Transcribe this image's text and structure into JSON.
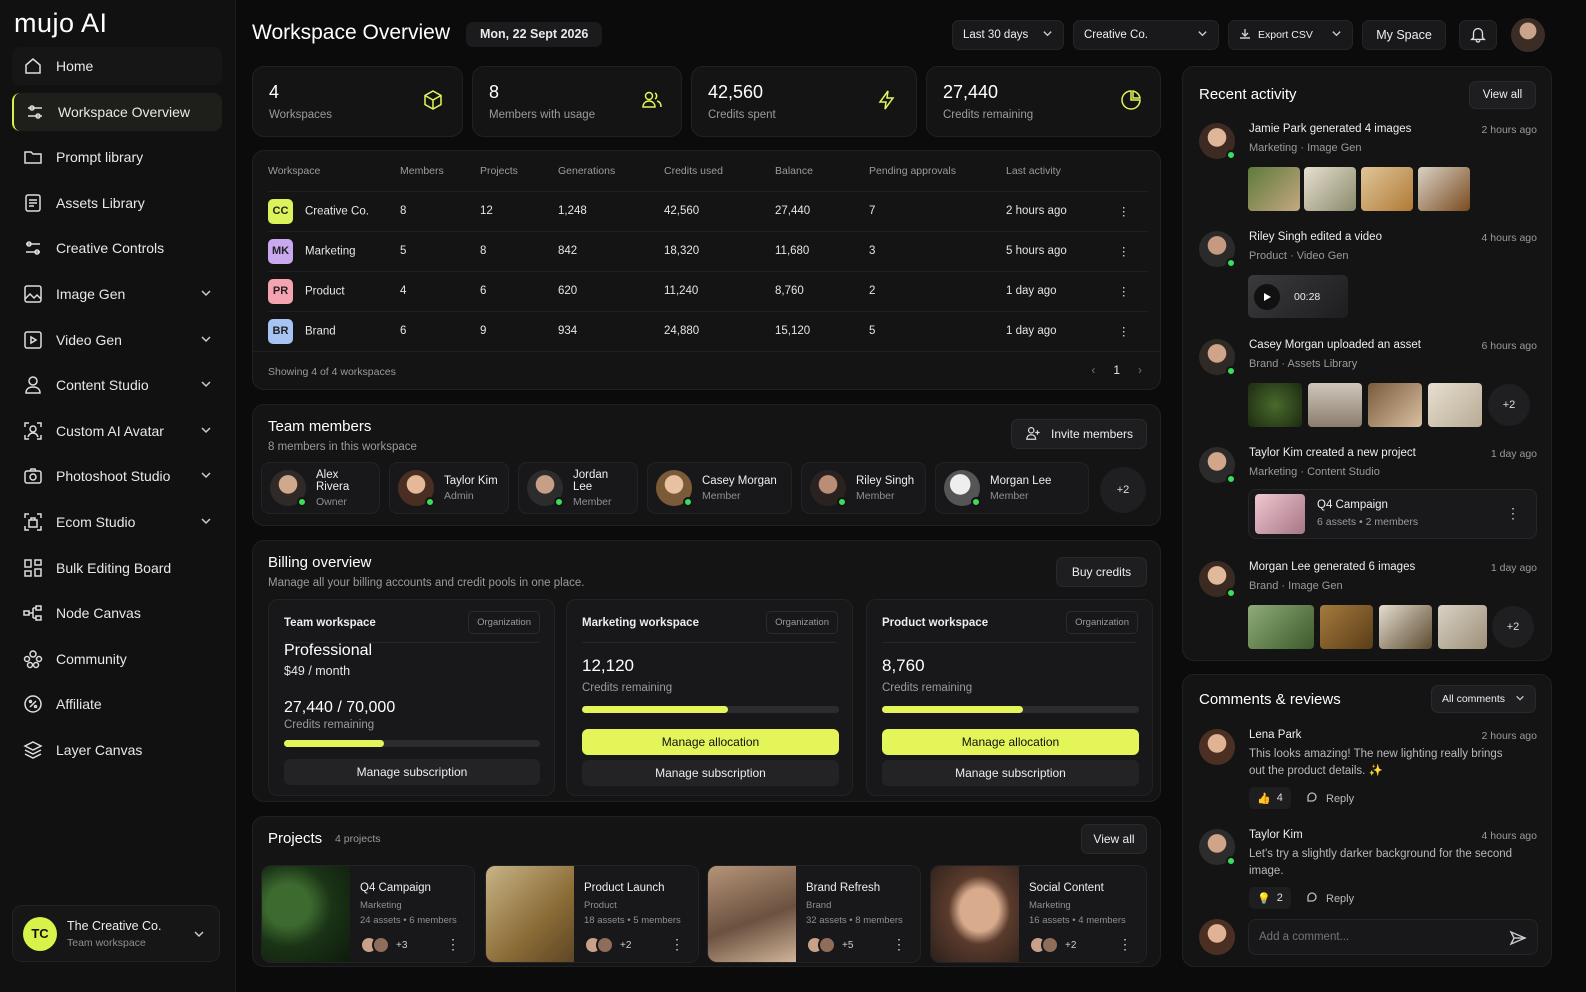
{
  "brand": "mujo AI",
  "sidebar": {
    "items": [
      {
        "label": "Home"
      },
      {
        "label": "Workspace Overview"
      },
      {
        "label": "Prompt library"
      },
      {
        "label": "Assets Library"
      },
      {
        "label": "Creative Controls"
      },
      {
        "label": "Image Gen"
      },
      {
        "label": "Video Gen"
      },
      {
        "label": "Content Studio"
      },
      {
        "label": "Custom AI Avatar"
      },
      {
        "label": "Photoshoot Studio"
      },
      {
        "label": "Ecom Studio"
      },
      {
        "label": "Bulk Editing Board"
      },
      {
        "label": "Node Canvas"
      },
      {
        "label": "Community"
      },
      {
        "label": "Affiliate"
      },
      {
        "label": "Layer Canvas"
      }
    ],
    "org": {
      "initials": "TC",
      "name": "The Creative Co.",
      "sub": "Team workspace"
    }
  },
  "header": {
    "title": "Workspace Overview",
    "date": "Mon, 22 Sept 2026",
    "range": "Last 30 days",
    "org": "Creative Co.",
    "export": "Export CSV",
    "my_space": "My Space"
  },
  "stats": [
    {
      "value": "4",
      "label": "Workspaces"
    },
    {
      "value": "8",
      "label": "Members with usage"
    },
    {
      "value": "42,560",
      "label": "Credits spent"
    },
    {
      "value": "27,440",
      "label": "Credits remaining"
    }
  ],
  "workspaces": {
    "columns": [
      "Workspace",
      "Members",
      "Projects",
      "Generations",
      "Credits used",
      "Balance",
      "Pending approvals",
      "Last activity"
    ],
    "rows": [
      {
        "badge": "CC",
        "name": "Creative Co.",
        "members": "8",
        "projects": "12",
        "generations": "1,248",
        "used": "42,560",
        "balance": "27,440",
        "pending": "7",
        "last": "2 hours ago",
        "color": "#dcf25a"
      },
      {
        "badge": "MK",
        "name": "Marketing",
        "members": "5",
        "projects": "8",
        "generations": "842",
        "used": "18,320",
        "balance": "11,680",
        "pending": "3",
        "last": "5 hours ago",
        "color": "#c9a8f0"
      },
      {
        "badge": "PR",
        "name": "Product",
        "members": "4",
        "projects": "6",
        "generations": "620",
        "used": "11,240",
        "balance": "8,760",
        "pending": "2",
        "last": "1 day ago",
        "color": "#f5a3b0"
      },
      {
        "badge": "BR",
        "name": "Brand",
        "members": "6",
        "projects": "9",
        "generations": "934",
        "used": "24,880",
        "balance": "15,120",
        "pending": "5",
        "last": "1 day ago",
        "color": "#a7c3f2"
      }
    ],
    "footer": "Showing 4 of 4 workspaces",
    "page": "1"
  },
  "team": {
    "title": "Team members",
    "subtitle": "8 members in this workspace",
    "invite": "Invite members",
    "members": [
      {
        "name": "Alex Rivera",
        "role": "Owner"
      },
      {
        "name": "Taylor Kim",
        "role": "Admin"
      },
      {
        "name": "Jordan Lee",
        "role": "Member"
      },
      {
        "name": "Casey Morgan",
        "role": "Member"
      },
      {
        "name": "Riley Singh",
        "role": "Member"
      },
      {
        "name": "Morgan Lee",
        "role": "Member"
      }
    ],
    "more": "+2"
  },
  "billing": {
    "title": "Billing overview",
    "subtitle": "Manage all your billing accounts and credit pools in one place.",
    "buy": "Buy credits",
    "tag": "Organization",
    "team": {
      "title": "Team workspace",
      "plan": "Professional",
      "price": "$49 / month",
      "credits": "27,440 / 70,000",
      "credits_label": "Credits remaining",
      "progress": 0.39,
      "manage": "Manage subscription"
    },
    "marketing": {
      "title": "Marketing workspace",
      "credits": "12,120",
      "credits_label": "Credits remaining",
      "progress": 0.57,
      "allocate": "Manage allocation",
      "manage": "Manage subscription"
    },
    "product": {
      "title": "Product workspace",
      "credits": "8,760",
      "credits_label": "Credits remaining",
      "progress": 0.55,
      "allocate": "Manage allocation",
      "manage": "Manage subscription"
    }
  },
  "projects": {
    "title": "Projects",
    "count": "4 projects",
    "view_all": "View all",
    "items": [
      {
        "name": "Q4 Campaign",
        "ws": "Marketing",
        "meta": "24 assets • 6 members",
        "more": "+3"
      },
      {
        "name": "Product Launch",
        "ws": "Product",
        "meta": "18 assets • 5 members",
        "more": "+2"
      },
      {
        "name": "Brand Refresh",
        "ws": "Brand",
        "meta": "32 assets • 8 members",
        "more": "+5"
      },
      {
        "name": "Social Content",
        "ws": "Marketing",
        "meta": "16 assets • 4 members",
        "more": "+2"
      }
    ]
  },
  "activity": {
    "title": "Recent activity",
    "view_all": "View all",
    "items": [
      {
        "who": "Jamie Park generated 4 images",
        "when": "2 hours ago",
        "ws": "Marketing",
        "tool": "Image Gen"
      },
      {
        "who": "Riley Singh edited a video",
        "when": "4 hours ago",
        "ws": "Product",
        "tool": "Video Gen",
        "duration": "00:28"
      },
      {
        "who": "Casey Morgan uploaded an asset",
        "when": "6 hours ago",
        "ws": "Brand",
        "tool": "Assets Library",
        "more": "+2"
      },
      {
        "who": "Taylor Kim created a new project",
        "when": "1 day ago",
        "ws": "Marketing",
        "tool": "Content Studio",
        "project": "Q4 Campaign",
        "project_meta": "6 assets • 2 members"
      },
      {
        "who": "Morgan Lee generated 6 images",
        "when": "1 day ago",
        "ws": "Brand",
        "tool": "Image Gen",
        "more": "+2"
      }
    ]
  },
  "comments": {
    "title": "Comments & reviews",
    "filter": "All comments",
    "items": [
      {
        "who": "Lena Park",
        "when": "2 hours ago",
        "text": "This looks amazing! The new lighting really brings out the product details. ✨",
        "count": "4",
        "reply": "Reply"
      },
      {
        "who": "Taylor Kim",
        "when": "4 hours ago",
        "text": "Let's try a slightly darker background for the second image.",
        "count": "2",
        "reply": "Reply"
      }
    ],
    "placeholder": "Add a comment..."
  },
  "colors": {
    "accent": "#e4f55a",
    "online": "#3ddc5a"
  }
}
